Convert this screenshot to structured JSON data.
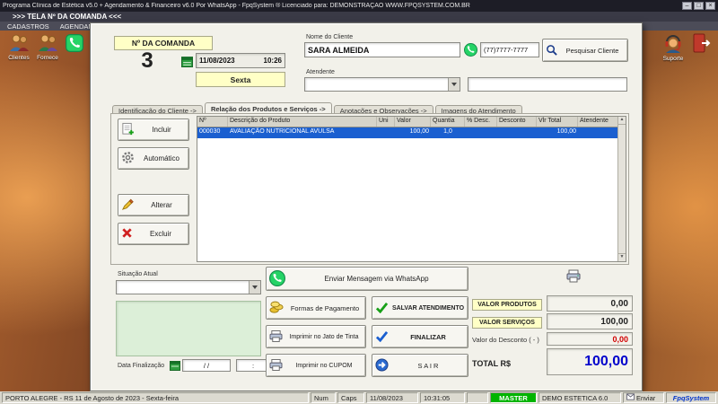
{
  "app": {
    "title": "Programa Clínica de Estética v5.0 + Agendamento & Financeiro v6.0 Por WhatsApp - FpqSystem ® Licenciado para: DEMONSTRAÇÃO WWW.FPQSYSTEM.COM.BR",
    "window_controls": {
      "minimize": "–",
      "maximize": "□",
      "close": "×"
    }
  },
  "tabstrip": {
    "label": ">>>   TELA Nº DA COMANDA   <<<"
  },
  "menubar": {
    "items": [
      {
        "label": "CADASTROS"
      },
      {
        "label": "AGENDAMENTOS"
      }
    ]
  },
  "toolbar": {
    "clientes_label": "Clientes",
    "fornecedores_label": "Fornece",
    "suporte_label": "Suporte"
  },
  "header": {
    "comanda_label": "Nº DA COMANDA",
    "comanda_numero": "3",
    "data": "11/08/2023",
    "hora": "10:26",
    "dia_semana": "Sexta",
    "nome_cliente_label": "Nome do Cliente",
    "nome_cliente": "SARA ALMEIDA",
    "telefone": "(77)7777-7777",
    "pesquisar_cliente_label": "Pesquisar Cliente",
    "atendente_label": "Atendente"
  },
  "tabs": [
    {
      "label": "Identificação do Cliente ->"
    },
    {
      "label": "Relação dos Produtos e Serviços ->"
    },
    {
      "label": "Anotações e Observações ->"
    },
    {
      "label": "Imagens do Atendimento"
    }
  ],
  "grid": {
    "columns": [
      "Nº",
      "Descrição do Produto",
      "Uni",
      "Valor",
      "Quantia",
      "% Desc.",
      "Desconto",
      "Vlr Total",
      "Atendente"
    ],
    "row": {
      "numero": "000030",
      "descricao": "AVALIAÇÃO NUTRICIONAL AVULSA",
      "uni": "",
      "valor": "100,00",
      "quantia": "1,0",
      "perc_desc": "",
      "desconto": "",
      "vlr_total": "100,00",
      "atendente": ""
    }
  },
  "actions": {
    "incluir": "Incluir",
    "automatico": "Automático",
    "alterar": "Alterar",
    "excluir": "Excluir"
  },
  "situacao": {
    "label": "Situação Atual"
  },
  "finalizacao": {
    "label": "Data Finalização",
    "data": "/ /",
    "hora": ":"
  },
  "buttons": {
    "whatsapp": "Enviar Mensagem via WhatsApp",
    "formas_pagamento": "Formas de Pagamento",
    "salvar": "SALVAR  ATENDIMENTO",
    "imprimir_jato": "Imprimir no Jato de Tinta",
    "finalizar": "FINALIZAR",
    "imprimir_cupom": "Imprimir no CUPOM",
    "sair": "S A I R"
  },
  "totais": {
    "valor_produtos_label": "VALOR PRODUTOS",
    "valor_produtos": "0,00",
    "valor_servicos_label": "VALOR SERVIÇOS",
    "valor_servicos": "100,00",
    "desconto_label": "Valor do Desconto ( - )",
    "desconto": "0,00",
    "total_label": "TOTAL R$",
    "total": "100,00"
  },
  "statusbar": {
    "local_data": "PORTO ALEGRE - RS 11 de Agosto de 2023 - Sexta-feira",
    "num": "Num",
    "caps": "Caps",
    "data": "11/08/2023",
    "hora": "10:31:05",
    "usuario": "MASTER",
    "empresa": "DEMO ESTETICA 6.0",
    "enviar": "Enviar",
    "brand": "FpqSystem"
  },
  "colors": {
    "accent_green": "#25D366",
    "selection_blue": "#1a5fd0",
    "total_blue": "#0000cc",
    "desconto_red": "#d00000"
  }
}
